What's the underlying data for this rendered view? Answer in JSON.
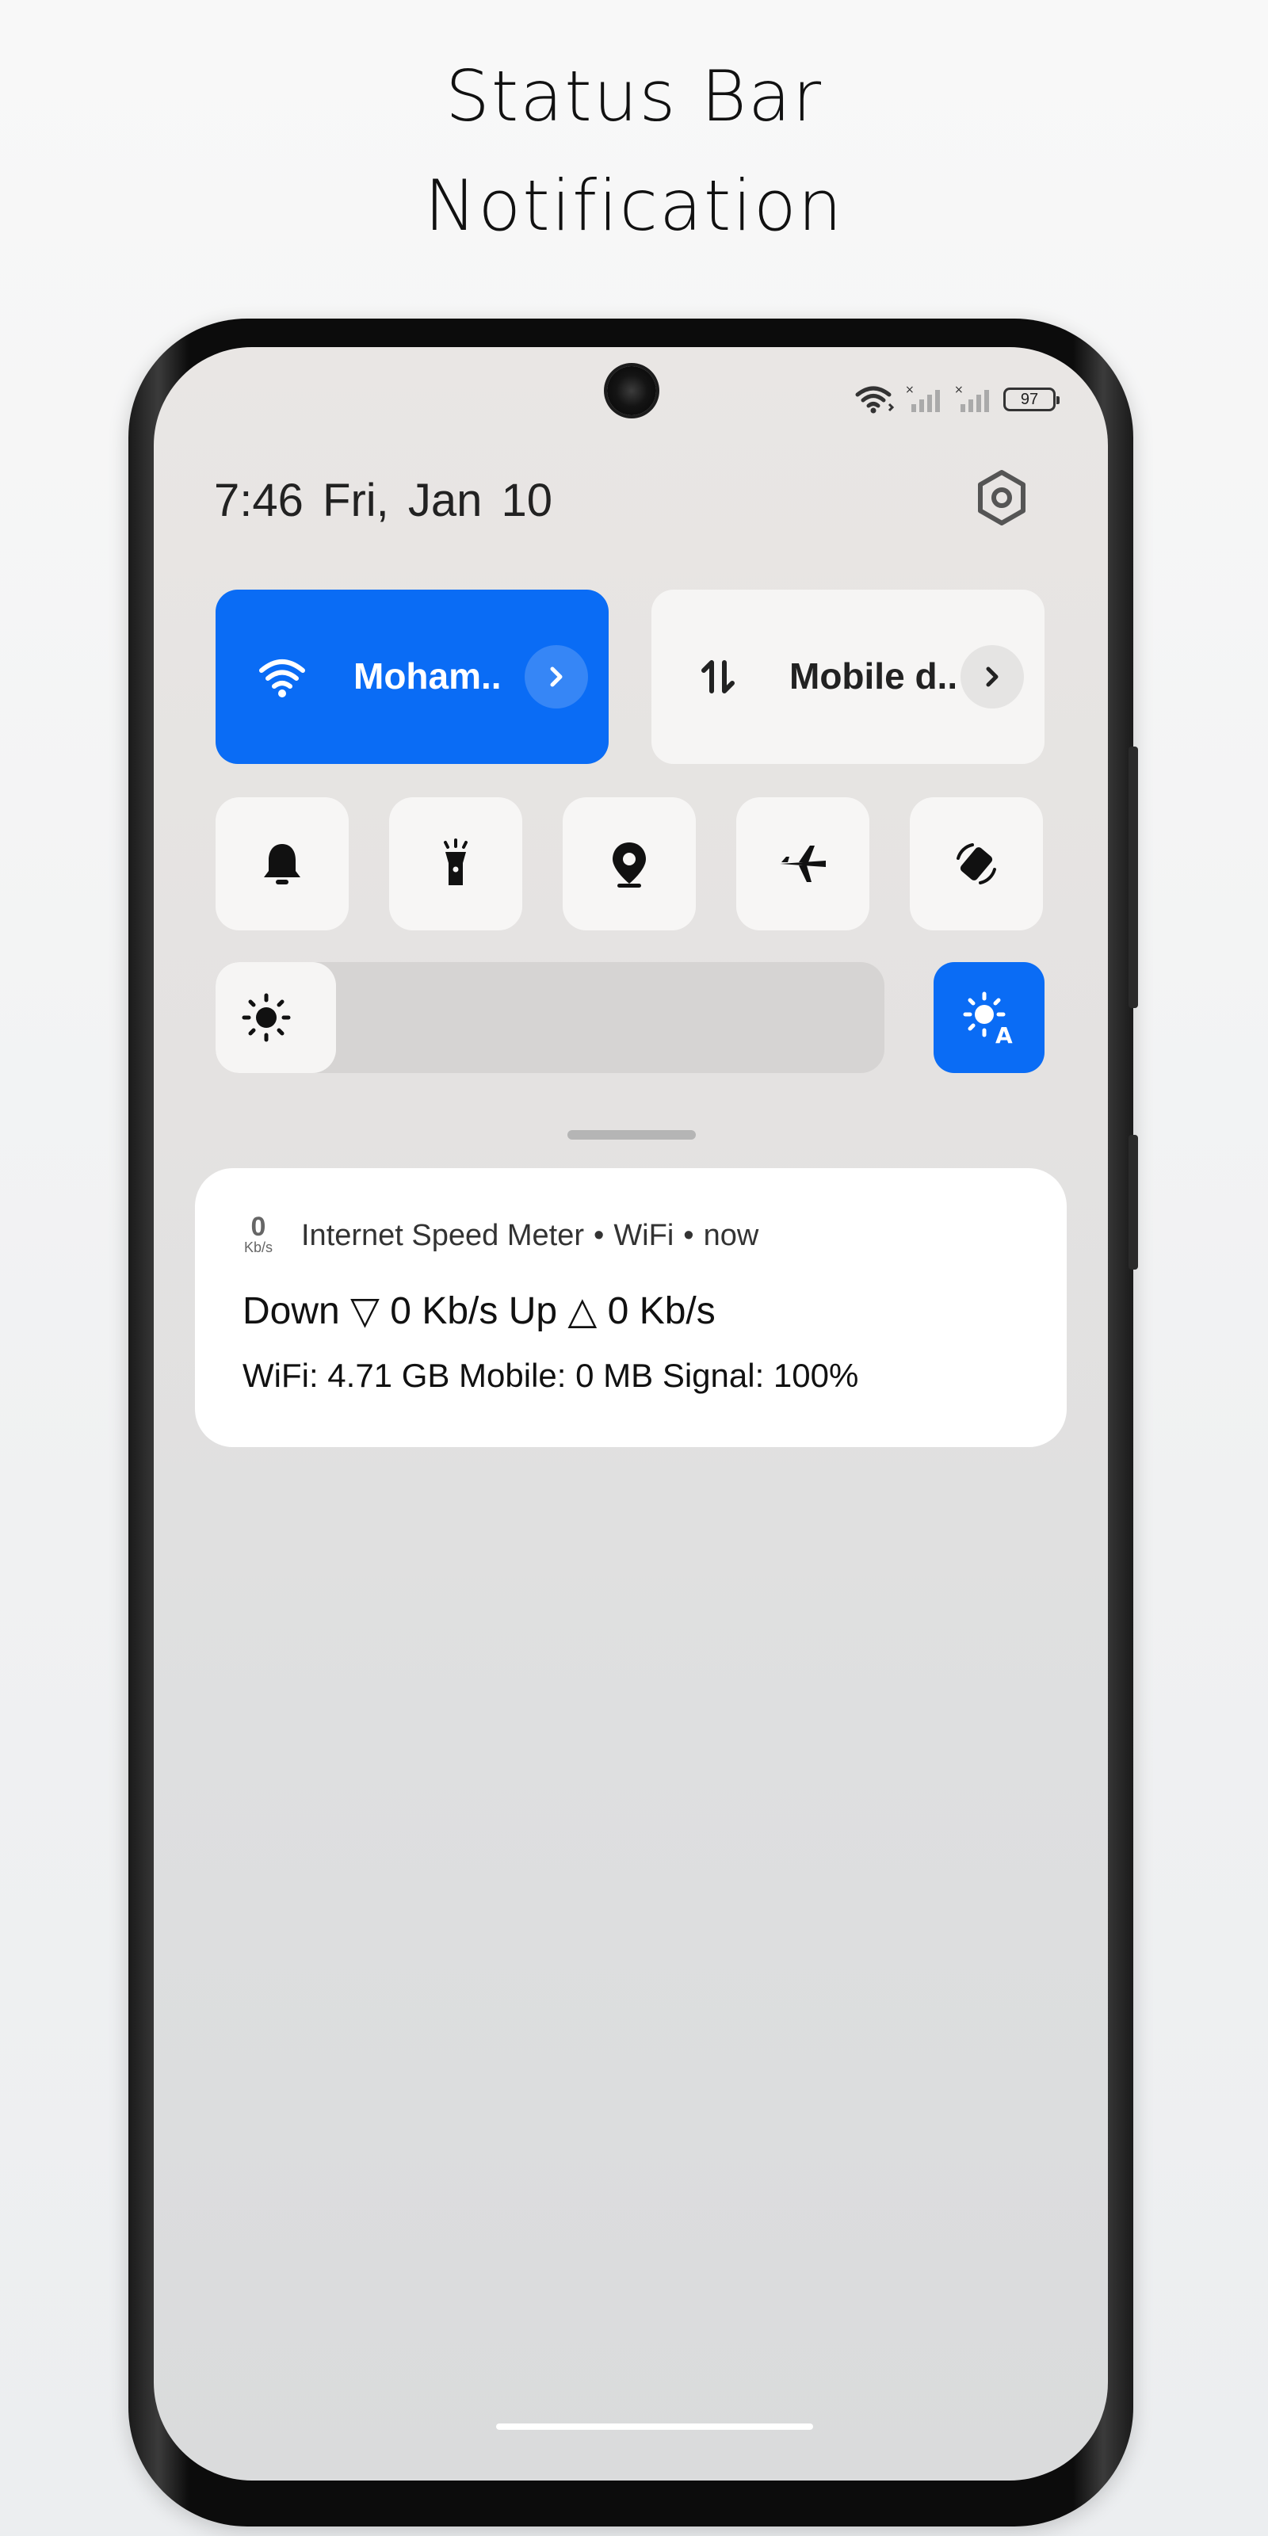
{
  "promo": {
    "title_line1": "Status Bar",
    "title_line2": "Notification"
  },
  "status_bar": {
    "battery": "97",
    "icons": [
      "wifi-icon",
      "signal-icon",
      "signal-icon",
      "battery-icon"
    ]
  },
  "header": {
    "time": "7:46",
    "date": "Fri, Jan 10"
  },
  "quick_settings": {
    "wifi_tile": {
      "label": "Moham..",
      "icon": "wifi-icon",
      "active": true
    },
    "mobile_tile": {
      "label": "Mobile d..",
      "icon": "data-arrows-icon",
      "active": false
    },
    "toggles": [
      "bell-icon",
      "flashlight-icon",
      "location-icon",
      "airplane-icon",
      "rotate-icon"
    ],
    "brightness_level": 0.18,
    "auto_brightness_active": true
  },
  "notification": {
    "app_icon_value": "0",
    "app_icon_unit": "Kb/s",
    "app": "Internet Speed Meter",
    "channel": "WiFi",
    "time": "now",
    "title": "Down ▽ 0 Kb/s Up △ 0 Kb/s",
    "body": "WiFi: 4.71 GB Mobile: 0 MB Signal: 100%"
  },
  "colors": {
    "accent": "#0a6cf5",
    "tile_bg": "#f6f5f4",
    "screen_bg": "#e4e2e1"
  }
}
